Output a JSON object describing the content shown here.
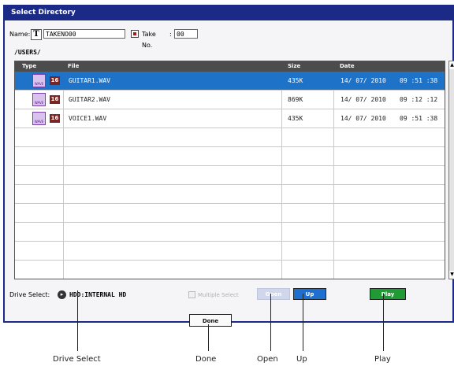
{
  "title": "Select Directory",
  "name_label": "Name:",
  "name_value": "TAKENO00",
  "take_label": "Take No.",
  "take_prefix": ":",
  "take_value": "00",
  "text_edit_icon": "T",
  "path": "/USERS/",
  "columns": {
    "type": "Type",
    "file": "File",
    "size": "Size",
    "date": "Date"
  },
  "files": [
    {
      "icon": "wave-file-icon",
      "badge": "16",
      "name": "GUITAR1.WAV",
      "size": "435K",
      "date": "14/ 07/ 2010",
      "time": "09 :51 :38",
      "selected": true
    },
    {
      "icon": "wave-file-icon",
      "badge": "16",
      "name": "GUITAR2.WAV",
      "size": "869K",
      "date": "14/ 07/ 2010",
      "time": "09 :12 :12",
      "selected": false
    },
    {
      "icon": "wave-file-icon",
      "badge": "16",
      "name": "VOICE1.WAV",
      "size": "435K",
      "date": "14/ 07/ 2010",
      "time": "09 :51 :38",
      "selected": false
    }
  ],
  "drive_label": "Drive Select:",
  "drive_value": "HDD:INTERNAL HD",
  "multiple_select_label": "Multiple Select",
  "buttons": {
    "open": "Open",
    "up": "Up",
    "play": "Play",
    "done": "Done"
  },
  "callouts": {
    "drive_select": "Drive Select",
    "done": "Done",
    "open": "Open",
    "up": "Up",
    "play": "Play"
  },
  "colors": {
    "title_bar": "#1a2a86",
    "selection": "#1e73c9",
    "up_button": "#1e6fd0",
    "play_button": "#1f9a34"
  }
}
